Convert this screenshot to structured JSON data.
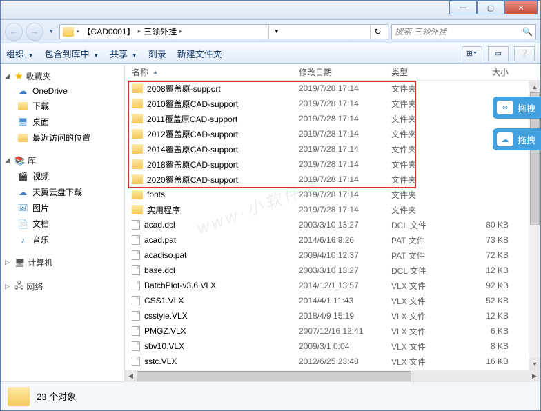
{
  "window": {
    "min": "—",
    "max": "▢",
    "close": "✕"
  },
  "nav": {
    "back": "←",
    "forward": "→",
    "dropdown": "▼"
  },
  "breadcrumb": {
    "part1": "【CAD0001】",
    "part2": "三领外挂",
    "sep": "▸"
  },
  "search": {
    "placeholder": "搜索 三领外挂",
    "icon": "🔍"
  },
  "refresh": "↻",
  "toolbar": {
    "organize": "组织",
    "include": "包含到库中",
    "share": "共享",
    "burn": "刻录",
    "newfolder": "新建文件夹",
    "dropdown": "▼"
  },
  "sidebar": {
    "favorites": "收藏夹",
    "onedrive": "OneDrive",
    "downloads": "下载",
    "desktop": "桌面",
    "recent": "最近访问的位置",
    "libraries": "库",
    "videos": "视频",
    "tianyi": "天翼云盘下载",
    "pictures": "图片",
    "documents": "文档",
    "music": "音乐",
    "computer": "计算机",
    "network": "网络",
    "expand": "▷",
    "expand_open": "◢"
  },
  "columns": {
    "name": "名称",
    "date": "修改日期",
    "type": "类型",
    "size": "大小",
    "sort": "▲"
  },
  "files": [
    {
      "icon": "folder",
      "name": "2008覆盖原-support",
      "date": "2019/7/28 17:14",
      "type": "文件夹",
      "size": ""
    },
    {
      "icon": "folder",
      "name": "2010覆盖原CAD-support",
      "date": "2019/7/28 17:14",
      "type": "文件夹",
      "size": ""
    },
    {
      "icon": "folder",
      "name": "2011覆盖原CAD-support",
      "date": "2019/7/28 17:14",
      "type": "文件夹",
      "size": ""
    },
    {
      "icon": "folder",
      "name": "2012覆盖原CAD-support",
      "date": "2019/7/28 17:14",
      "type": "文件夹",
      "size": ""
    },
    {
      "icon": "folder",
      "name": "2014覆盖原CAD-support",
      "date": "2019/7/28 17:14",
      "type": "文件夹",
      "size": ""
    },
    {
      "icon": "folder",
      "name": "2018覆盖原CAD-support",
      "date": "2019/7/28 17:14",
      "type": "文件夹",
      "size": ""
    },
    {
      "icon": "folder",
      "name": "2020覆盖原CAD-support",
      "date": "2019/7/28 17:14",
      "type": "文件夹",
      "size": ""
    },
    {
      "icon": "folder",
      "name": "fonts",
      "date": "2019/7/28 17:14",
      "type": "文件夹",
      "size": ""
    },
    {
      "icon": "folder",
      "name": "实用程序",
      "date": "2019/7/28 17:14",
      "type": "文件夹",
      "size": ""
    },
    {
      "icon": "file",
      "name": "acad.dcl",
      "date": "2003/3/10 13:27",
      "type": "DCL 文件",
      "size": "80 KB"
    },
    {
      "icon": "file",
      "name": "acad.pat",
      "date": "2014/6/16 9:26",
      "type": "PAT 文件",
      "size": "73 KB"
    },
    {
      "icon": "file",
      "name": "acadiso.pat",
      "date": "2009/4/10 12:37",
      "type": "PAT 文件",
      "size": "72 KB"
    },
    {
      "icon": "file",
      "name": "base.dcl",
      "date": "2003/3/10 13:27",
      "type": "DCL 文件",
      "size": "12 KB"
    },
    {
      "icon": "file",
      "name": "BatchPlot-v3.6.VLX",
      "date": "2014/12/1 13:57",
      "type": "VLX 文件",
      "size": "92 KB"
    },
    {
      "icon": "file",
      "name": "CSS1.VLX",
      "date": "2014/4/1 11:43",
      "type": "VLX 文件",
      "size": "52 KB"
    },
    {
      "icon": "file",
      "name": "csstyle.VLX",
      "date": "2018/4/9 15:19",
      "type": "VLX 文件",
      "size": "12 KB"
    },
    {
      "icon": "file",
      "name": "PMGZ.VLX",
      "date": "2007/12/16 12:41",
      "type": "VLX 文件",
      "size": "6 KB"
    },
    {
      "icon": "file",
      "name": "sbv10.VLX",
      "date": "2009/3/1 0:04",
      "type": "VLX 文件",
      "size": "8 KB"
    },
    {
      "icon": "file",
      "name": "sstc.VLX",
      "date": "2012/6/25 23:48",
      "type": "VLX 文件",
      "size": "16 KB"
    }
  ],
  "status": {
    "count": "23 个对象"
  },
  "side": {
    "btn1": "拖拽",
    "btn2": "拖拽",
    "icon1": "∞",
    "icon2": "☁"
  },
  "watermark": "www·小软件迷"
}
